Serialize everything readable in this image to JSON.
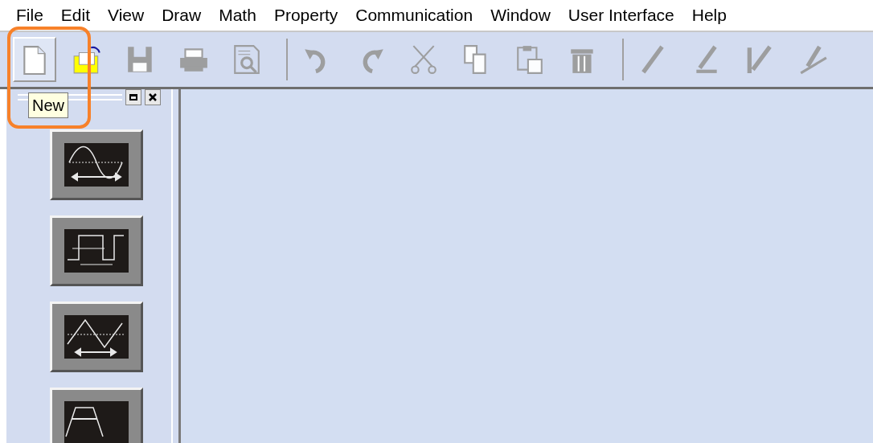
{
  "menu": [
    "File",
    "Edit",
    "View",
    "Draw",
    "Math",
    "Property",
    "Communication",
    "Window",
    "User Interface",
    "Help"
  ],
  "toolbar": [
    {
      "kind": "new",
      "disabled": false,
      "hovered": true
    },
    {
      "kind": "open",
      "disabled": false,
      "hovered": false
    },
    {
      "kind": "save",
      "disabled": true,
      "hovered": false
    },
    {
      "kind": "print",
      "disabled": true,
      "hovered": false
    },
    {
      "kind": "preview",
      "disabled": true,
      "hovered": false
    },
    {
      "kind": "separator"
    },
    {
      "kind": "undo",
      "disabled": true,
      "hovered": false
    },
    {
      "kind": "redo",
      "disabled": true,
      "hovered": false
    },
    {
      "kind": "cut",
      "disabled": true,
      "hovered": false
    },
    {
      "kind": "copy",
      "disabled": true,
      "hovered": false
    },
    {
      "kind": "paste",
      "disabled": true,
      "hovered": false
    },
    {
      "kind": "delete",
      "disabled": true,
      "hovered": false
    },
    {
      "kind": "separator"
    },
    {
      "kind": "pen",
      "disabled": true,
      "hovered": false
    },
    {
      "kind": "pen-angle",
      "disabled": true,
      "hovered": false
    },
    {
      "kind": "pen-v",
      "disabled": true,
      "hovered": false
    },
    {
      "kind": "pen-slant",
      "disabled": true,
      "hovered": false
    }
  ],
  "tooltip": "New",
  "palette": [
    {
      "kind": "sine"
    },
    {
      "kind": "square"
    },
    {
      "kind": "triangle"
    },
    {
      "kind": "trapezoid"
    }
  ]
}
